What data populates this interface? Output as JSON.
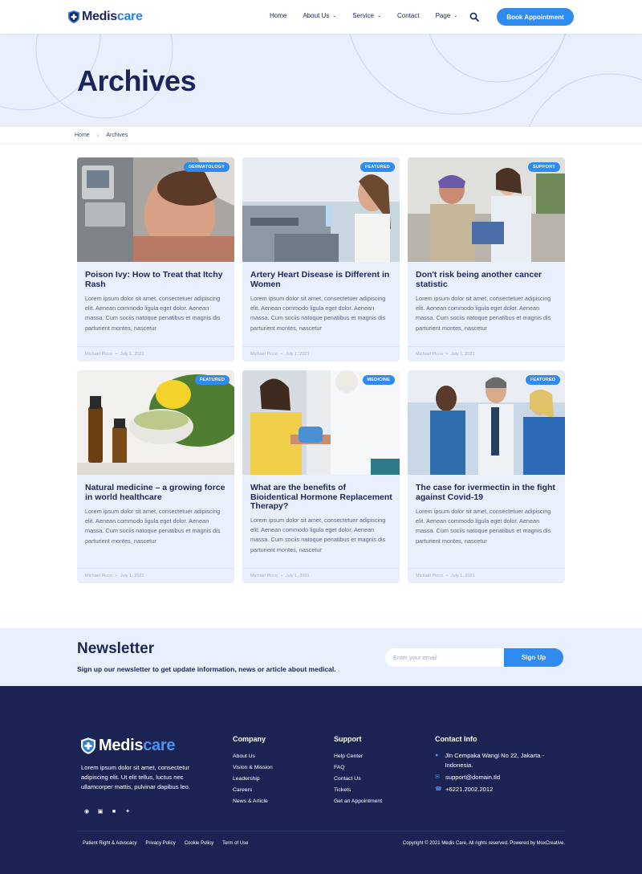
{
  "header": {
    "logo_dark": "Medis",
    "logo_blue": "care",
    "nav": [
      {
        "label": "Home",
        "dropdown": false
      },
      {
        "label": "About Us",
        "dropdown": true
      },
      {
        "label": "Service",
        "dropdown": true
      },
      {
        "label": "Contact",
        "dropdown": false
      },
      {
        "label": "Page",
        "dropdown": true
      }
    ],
    "cta": "Book Appointment"
  },
  "hero": {
    "title": "Archives"
  },
  "breadcrumb": {
    "home": "Home",
    "current": "Archives"
  },
  "posts": [
    {
      "badge": "DERMATOLOGY",
      "title": "Poison Ivy: How to Treat that Itchy Rash",
      "excerpt": "Lorem ipsum dolor sit amet, consectetuer adipiscing elit. Aenean commodo ligula eget dolor. Aenean massa. Cum sociis natoque penatibus et magnis dis parturient montes, nascetur",
      "author": "Michael Picco",
      "date": "July 1, 2021"
    },
    {
      "badge": "FEATURED",
      "title": "Artery Heart Disease is Different in Women",
      "excerpt": "Lorem ipsum dolor sit amet, consectetuer adipiscing elit. Aenean commodo ligula eget dolor. Aenean massa. Cum sociis natoque penatibus et magnis dis parturient montes, nascetur",
      "author": "Michael Picco",
      "date": "July 1, 2021"
    },
    {
      "badge": "SUPPORT",
      "title": "Don't risk being another cancer statistic",
      "excerpt": "Lorem ipsum dolor sit amet, consectetuer adipiscing elit. Aenean commodo ligula eget dolor. Aenean massa. Cum sociis natoque penatibus et magnis dis parturient montes, nascetur",
      "author": "Michael Picco",
      "date": "July 1, 2021"
    },
    {
      "badge": "FEATURED",
      "title": "Natural medicine – a growing force in world healthcare",
      "excerpt": "Lorem ipsum dolor sit amet, consectetuer adipiscing elit. Aenean commodo ligula eget dolor. Aenean massa. Cum sociis natoque penatibus et magnis dis parturient montes, nascetur",
      "author": "Michael Picco",
      "date": "July 1, 2021"
    },
    {
      "badge": "MEDICINE",
      "title": "What are the benefits of Bioidentical Hormone Replacement Therapy?",
      "excerpt": "Lorem ipsum dolor sit amet, consectetuer adipiscing elit. Aenean commodo ligula eget dolor. Aenean massa. Cum sociis natoque penatibus et magnis dis parturient montes, nascetur",
      "author": "Michael Picco",
      "date": "July 1, 2021"
    },
    {
      "badge": "FEATURED",
      "title": "The case for ivermectin in the fight against Covid-19",
      "excerpt": "Lorem ipsum dolor sit amet, consectetuer adipiscing elit. Aenean commodo ligula eget dolor. Aenean massa. Cum sociis natoque penatibus et magnis dis parturient montes, nascetur",
      "author": "Michael Picco",
      "date": "July 1, 2021"
    }
  ],
  "newsletter": {
    "title": "Newsletter",
    "subtitle": "Sign up our newsletter to get update information, news or article about medical.",
    "placeholder": "Enter your email",
    "button": "Sign Up"
  },
  "footer": {
    "description": "Lorem ipsum dolor sit amet, consectetur adipiscing elit. Ut elit tellus, luctus nec ullamcorper mattis, pulvinar dapibus leo.",
    "company": {
      "title": "Company",
      "links": [
        "About Us",
        "Vision & Mission",
        "Leadership",
        "Careers",
        "News & Article"
      ]
    },
    "support": {
      "title": "Support",
      "links": [
        "Help Center",
        "FAQ",
        "Contact Us",
        "Tickets",
        "Get an Appointment"
      ]
    },
    "contact": {
      "title": "Contact Info",
      "address": "Jln Cempaka Wangi No 22, Jakarta - Indonesia.",
      "email": "support@domain.tld",
      "phone": "+6221.2002.2012"
    },
    "legal": [
      "Patient Right & Advocacy",
      "Privacy Policy",
      "Cookie Policy",
      "Term of Use"
    ],
    "copyright": "Copyright © 2021 Medis Care, All rights reserved. Powered by MoxCreative."
  },
  "icons": {
    "social": [
      "facebook-icon",
      "instagram-icon",
      "linkedin-icon",
      "twitter-icon"
    ]
  },
  "colors": {
    "primary": "#2f8bf0",
    "navy": "#1b2352",
    "light_bg": "#eaf0fb",
    "heading": "#1b2559"
  }
}
